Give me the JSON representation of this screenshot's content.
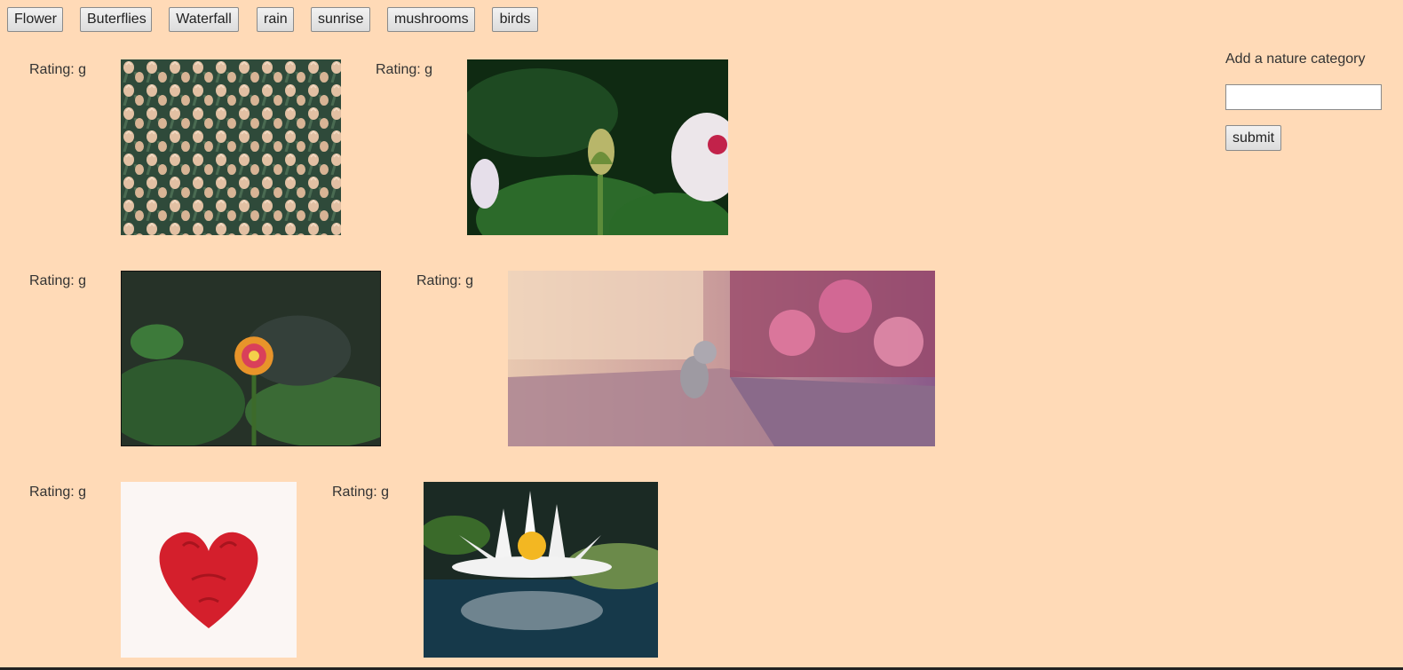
{
  "categories": [
    "Flower",
    "Buterflies",
    "Waterfall",
    "rain",
    "sunrise",
    "mushrooms",
    "birds"
  ],
  "gifs": [
    {
      "rating": "Rating: g",
      "alt": "tulips"
    },
    {
      "rating": "Rating: g",
      "alt": "flower bud"
    },
    {
      "rating": "Rating: g",
      "alt": "blooming flower"
    },
    {
      "rating": "Rating: g",
      "alt": "kitten with flowers"
    },
    {
      "rating": "Rating: g",
      "alt": "rose petal heart"
    },
    {
      "rating": "Rating: g",
      "alt": "water lily"
    }
  ],
  "sidebar": {
    "label": "Add a nature category",
    "input_value": "",
    "submit_label": "submit"
  }
}
